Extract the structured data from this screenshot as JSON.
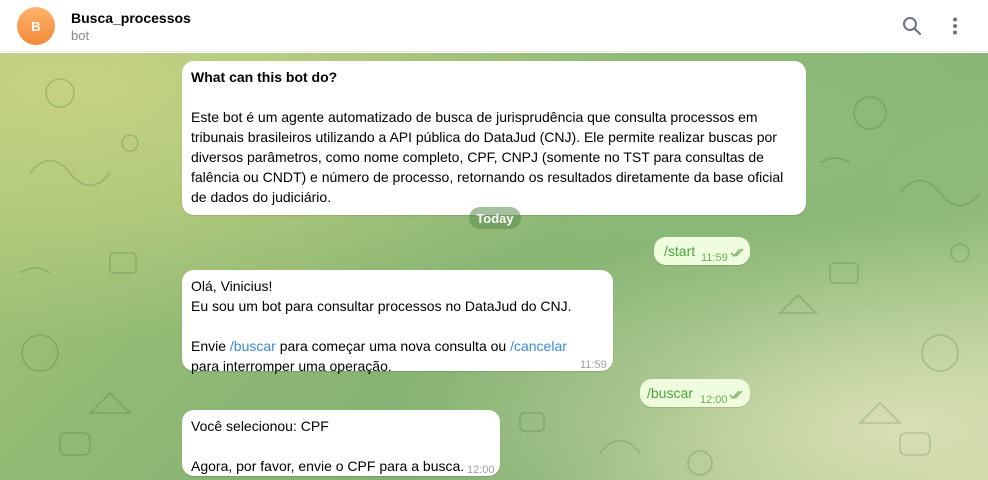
{
  "header": {
    "avatar_letter": "B",
    "title": "Busca_processos",
    "subtitle": "bot"
  },
  "bot_info": {
    "question": "What can this bot do?",
    "description": "Este bot é um agente automatizado de busca de jurisprudência que consulta processos em\ntribunais brasileiros utilizando a API pública do DataJud (CNJ). Ele permite realizar buscas por\ndiversos parâmetros, como nome completo, CPF, CNPJ (somente no TST para consultas de\nfalência ou CNDT) e número de processo, retornando os resultados diretamente da base oficial\nde dados do judiciário."
  },
  "date_separator": "Today",
  "messages": [
    {
      "direction": "out",
      "text": "/start",
      "time": "11:59"
    },
    {
      "direction": "in",
      "line1": "Olá, Vinicius!",
      "line2": "Eu sou um bot para consultar processos no DataJud do CNJ.",
      "line3_pre": "Envie ",
      "cmd_buscar": "/buscar",
      "line3_mid": " para começar uma nova consulta ou ",
      "cmd_cancelar": "/cancelar",
      "line4": "para interromper uma operação.",
      "time": "11:59"
    },
    {
      "direction": "out",
      "text": "/buscar",
      "time": "12:00"
    },
    {
      "direction": "in",
      "line1": "Você selecionou: CPF",
      "line2": "Agora, por favor, envie o CPF para a busca.",
      "time": "12:00"
    }
  ],
  "icons": {
    "search": "search-icon",
    "menu": "more-vertical-icon",
    "read": "double-check-icon"
  },
  "colors": {
    "avatar": "#f28a3a",
    "outgoing_bubble": "#effdde",
    "link": "#3a8ad6",
    "command_text": "#4ba43a"
  }
}
